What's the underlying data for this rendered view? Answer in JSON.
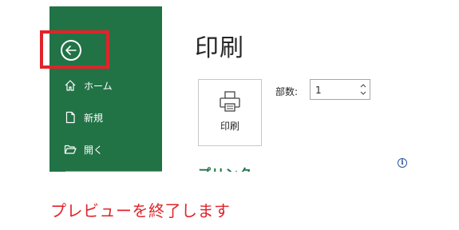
{
  "sidebar": {
    "back_icon": "back-arrow-icon",
    "items": [
      {
        "label": "ホーム",
        "icon": "home-icon"
      },
      {
        "label": "新規",
        "icon": "new-document-icon"
      },
      {
        "label": "開く",
        "icon": "open-folder-icon"
      }
    ]
  },
  "main": {
    "title": "印刷",
    "print_button": {
      "label": "印刷",
      "icon": "printer-icon"
    },
    "copies": {
      "label": "部数:",
      "value": "1"
    },
    "printer_section": "プリンター",
    "info_icon": "info-icon"
  },
  "annotation": {
    "caption": "プレビューを終了します",
    "highlight_color": "#e0242a"
  },
  "colors": {
    "sidebar_bg": "#217346",
    "accent": "#217346",
    "annotation": "#e0242a"
  }
}
